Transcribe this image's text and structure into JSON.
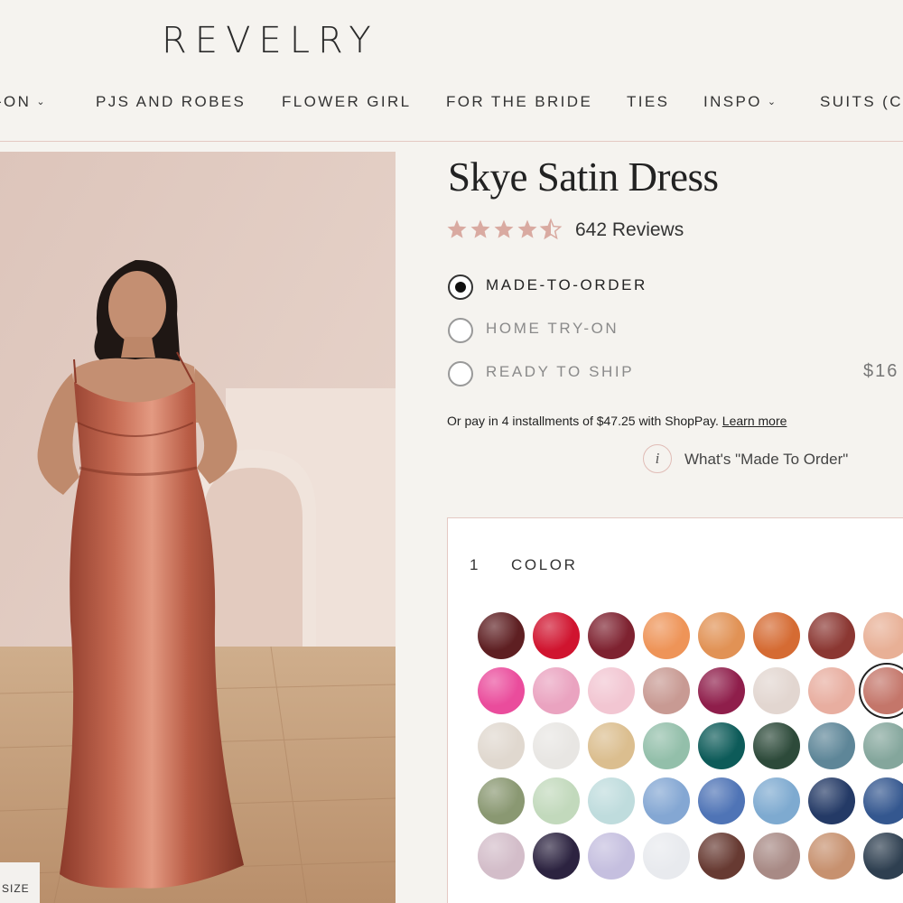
{
  "brand": {
    "logo": "REVELRY"
  },
  "nav": [
    {
      "label": "-ON",
      "dropdown": true
    },
    {
      "label": "PJS AND ROBES",
      "dropdown": false
    },
    {
      "label": "FLOWER GIRL",
      "dropdown": false
    },
    {
      "label": "FOR THE BRIDE",
      "dropdown": false
    },
    {
      "label": "TIES",
      "dropdown": false
    },
    {
      "label": "INSPO",
      "dropdown": true
    },
    {
      "label": "SUITS (CO",
      "dropdown": false
    }
  ],
  "photo": {
    "size_tag": "SIZE"
  },
  "product": {
    "title": "Skye Satin Dress",
    "rating": 4.5,
    "reviews_label": "642 Reviews",
    "options": [
      {
        "label": "MADE-TO-ORDER",
        "selected": true,
        "price": ""
      },
      {
        "label": "HOME TRY-ON",
        "selected": false,
        "price": ""
      },
      {
        "label": "READY TO SHIP",
        "selected": false,
        "price": "$16"
      }
    ],
    "installments_text": "Or pay in 4 installments of $47.25 with ShopPay.",
    "learn_more": "Learn more",
    "info_icon": "i",
    "info_text": "What's \"Made To Order\""
  },
  "colors": {
    "step_number": "1",
    "step_label": "COLOR",
    "selected_index": 15,
    "rows": [
      [
        "#5e1f22",
        "#d0142f",
        "#7e2230",
        "#ee9458",
        "#e19255",
        "#d56b33",
        "#8b3732",
        "#e8b096"
      ],
      [
        "#ea4c9c",
        "#eaa3c0",
        "#f2c6d2",
        "#c89a93",
        "#8f1e4b",
        "#e2d6d0",
        "#e8aea0",
        "#c4766a"
      ],
      [
        "#e0d8cf",
        "#e8e6e3",
        "#dbbe8f",
        "#93bfaa",
        "#0d5b59",
        "#2d4a3a",
        "#5e8698",
        "#84a69c"
      ],
      [
        "#8a9872",
        "#c2d9bc",
        "#bfdcdd",
        "#84a7d3",
        "#4f74b6",
        "#7eaad0",
        "#243a66",
        "#34578f"
      ],
      [
        "#d3bdc9",
        "#2c2340",
        "#c5bfdf",
        "#e8eaee",
        "#673a32",
        "#a88a85",
        "#c7916f",
        "#2e3f50"
      ]
    ]
  }
}
